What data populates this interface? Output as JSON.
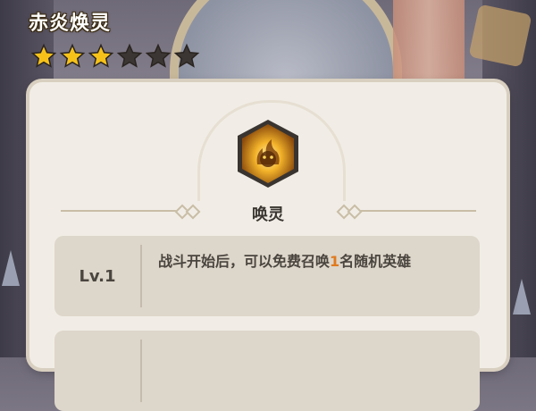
{
  "hero": {
    "name": "赤炎焕灵",
    "stars_filled": 3,
    "stars_total": 6
  },
  "skill": {
    "name": "唤灵",
    "icon": "fire-spirit-icon"
  },
  "levels": [
    {
      "label": "Lv.1",
      "desc_before": "战斗开始后，可以免费召唤",
      "highlight": "1",
      "desc_after": "名随机英雄"
    },
    {
      "label": "",
      "desc_before": "",
      "highlight": "",
      "desc_after": ""
    }
  ],
  "colors": {
    "star_filled": "#f6c21a",
    "star_empty": "#3b3633",
    "highlight": "#e07a1f",
    "panel": "#f1ede6"
  }
}
